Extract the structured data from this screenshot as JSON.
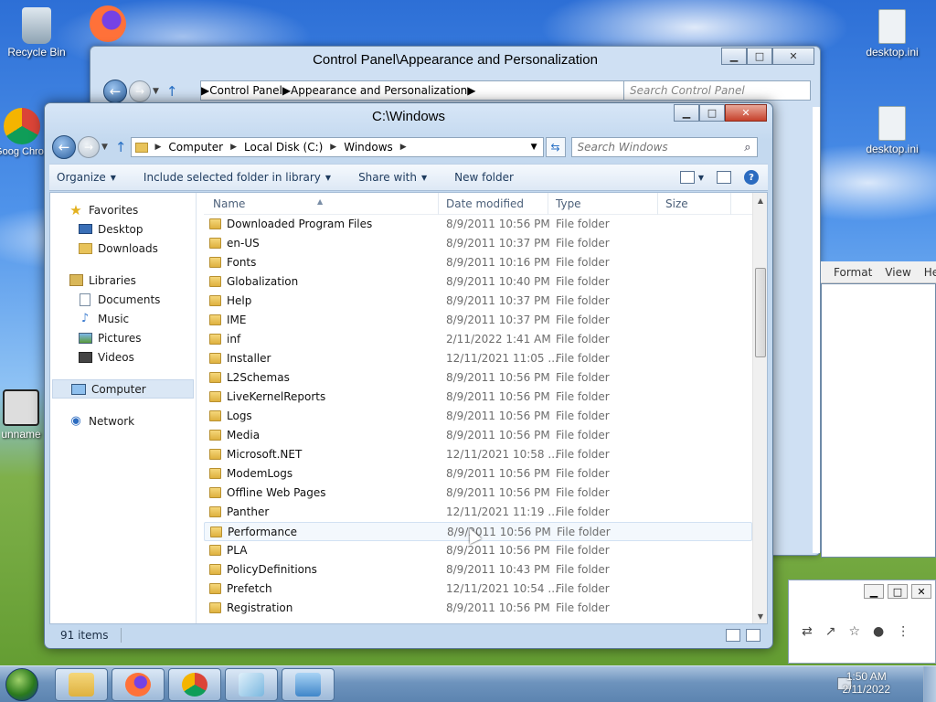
{
  "desktop": {
    "icons": [
      {
        "label": "Recycle Bin"
      },
      {
        "label": "desktop.ini"
      },
      {
        "label": "desktop.ini"
      },
      {
        "label": "Goog Chron"
      },
      {
        "label": "unname"
      }
    ]
  },
  "back_window": {
    "title": "Control Panel\\Appearance and Personalization",
    "breadcrumb": [
      "Control Panel",
      "Appearance and Personalization"
    ],
    "search_placeholder": "Search Control Panel"
  },
  "window": {
    "title": "C:\\Windows",
    "breadcrumb": [
      "Computer",
      "Local Disk (C:)",
      "Windows"
    ],
    "search_placeholder": "Search Windows",
    "toolbar": {
      "organize": "Organize",
      "include": "Include selected folder in library",
      "share": "Share with",
      "new_folder": "New folder"
    },
    "sidebar": {
      "favorites": {
        "label": "Favorites",
        "items": [
          "Desktop",
          "Downloads"
        ]
      },
      "libraries": {
        "label": "Libraries",
        "items": [
          "Documents",
          "Music",
          "Pictures",
          "Videos"
        ]
      },
      "computer": "Computer",
      "network": "Network"
    },
    "columns": {
      "name": "Name",
      "date": "Date modified",
      "type": "Type",
      "size": "Size"
    },
    "rows": [
      {
        "name": "Downloaded Program Files",
        "date": "8/9/2011 10:56 PM",
        "type": "File folder"
      },
      {
        "name": "en-US",
        "date": "8/9/2011 10:37 PM",
        "type": "File folder"
      },
      {
        "name": "Fonts",
        "date": "8/9/2011 10:16 PM",
        "type": "File folder"
      },
      {
        "name": "Globalization",
        "date": "8/9/2011 10:40 PM",
        "type": "File folder"
      },
      {
        "name": "Help",
        "date": "8/9/2011 10:37 PM",
        "type": "File folder"
      },
      {
        "name": "IME",
        "date": "8/9/2011 10:37 PM",
        "type": "File folder"
      },
      {
        "name": "inf",
        "date": "2/11/2022 1:41 AM",
        "type": "File folder"
      },
      {
        "name": "Installer",
        "date": "12/11/2021 11:05 ...",
        "type": "File folder"
      },
      {
        "name": "L2Schemas",
        "date": "8/9/2011 10:56 PM",
        "type": "File folder"
      },
      {
        "name": "LiveKernelReports",
        "date": "8/9/2011 10:56 PM",
        "type": "File folder"
      },
      {
        "name": "Logs",
        "date": "8/9/2011 10:56 PM",
        "type": "File folder"
      },
      {
        "name": "Media",
        "date": "8/9/2011 10:56 PM",
        "type": "File folder"
      },
      {
        "name": "Microsoft.NET",
        "date": "12/11/2021 10:58 ...",
        "type": "File folder"
      },
      {
        "name": "ModemLogs",
        "date": "8/9/2011 10:56 PM",
        "type": "File folder"
      },
      {
        "name": "Offline Web Pages",
        "date": "8/9/2011 10:56 PM",
        "type": "File folder"
      },
      {
        "name": "Panther",
        "date": "12/11/2021 11:19 ...",
        "type": "File folder"
      },
      {
        "name": "Performance",
        "date": "8/9/2011 10:56 PM",
        "type": "File folder"
      },
      {
        "name": "PLA",
        "date": "8/9/2011 10:56 PM",
        "type": "File folder"
      },
      {
        "name": "PolicyDefinitions",
        "date": "8/9/2011 10:43 PM",
        "type": "File folder"
      },
      {
        "name": "Prefetch",
        "date": "12/11/2021 10:54 ...",
        "type": "File folder"
      },
      {
        "name": "Registration",
        "date": "8/9/2011 10:56 PM",
        "type": "File folder"
      }
    ],
    "hovered_row": "Performance",
    "status": "91 items"
  },
  "notepad_menu": [
    "Format",
    "View",
    "Help"
  ],
  "taskbar": {
    "time": "1:50 AM",
    "date": "2/11/2022"
  },
  "colors": {
    "accent": "#2b6bc0",
    "folder": "#e8c35a"
  }
}
